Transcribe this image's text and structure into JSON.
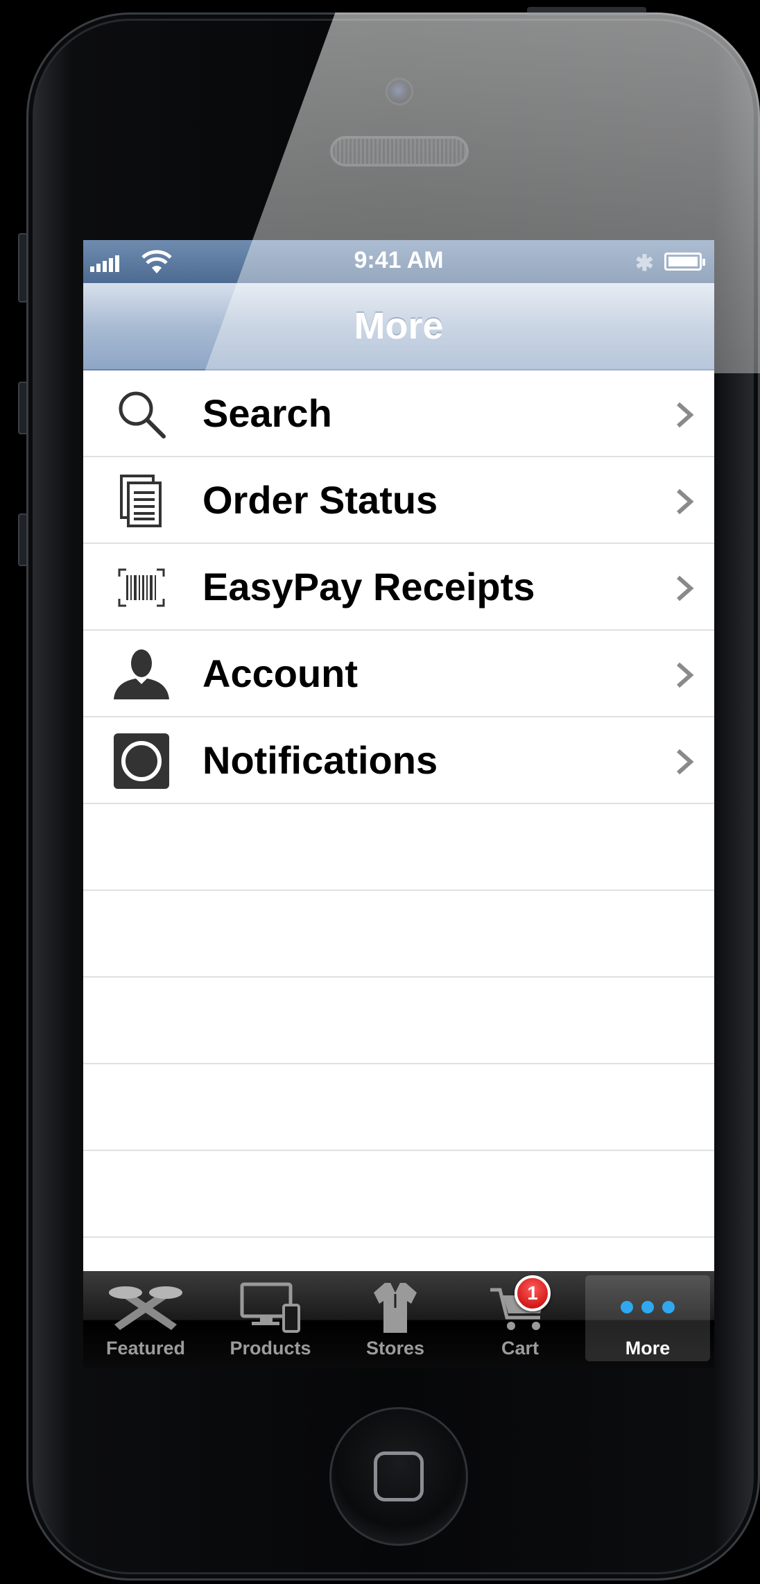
{
  "status_bar": {
    "time": "9:41 AM"
  },
  "nav": {
    "title": "More"
  },
  "menu": {
    "items": [
      {
        "label": "Search",
        "icon": "search-icon"
      },
      {
        "label": "Order Status",
        "icon": "document-icon"
      },
      {
        "label": "EasyPay Receipts",
        "icon": "barcode-icon"
      },
      {
        "label": "Account",
        "icon": "person-icon"
      },
      {
        "label": "Notifications",
        "icon": "notification-icon"
      }
    ]
  },
  "tab_bar": {
    "tabs": [
      {
        "label": "Featured",
        "icon": "featured-icon"
      },
      {
        "label": "Products",
        "icon": "devices-icon"
      },
      {
        "label": "Stores",
        "icon": "shirt-icon"
      },
      {
        "label": "Cart",
        "icon": "cart-icon",
        "badge": "1"
      },
      {
        "label": "More",
        "icon": "more-dots-icon",
        "selected": true
      }
    ]
  },
  "colors": {
    "status_bar": "#5b7aa0",
    "nav_bar": "#a9bbd3",
    "badge": "#d40000",
    "tab_active_dots": "#2fa8f0"
  }
}
